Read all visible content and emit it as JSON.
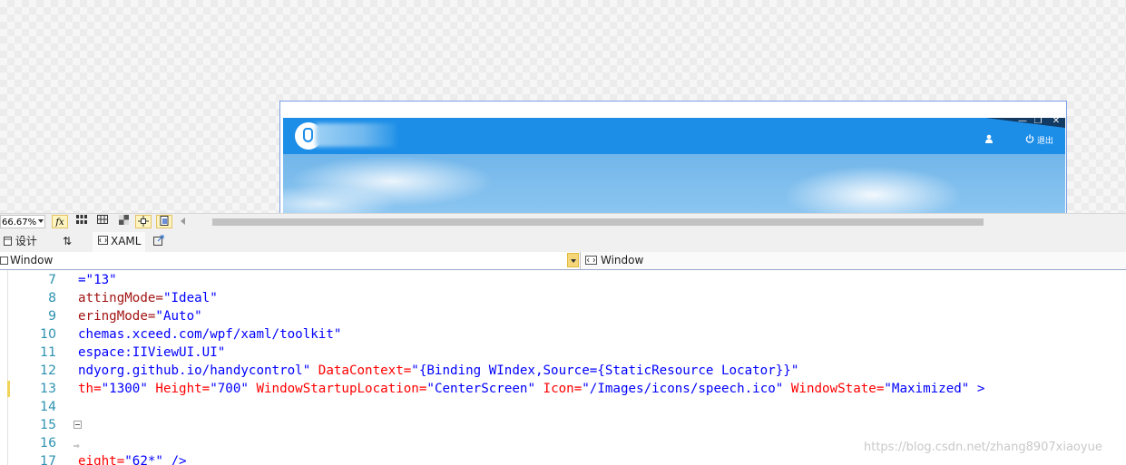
{
  "designer": {
    "app_preview": {
      "window_buttons": [
        "—",
        "❐",
        "✕"
      ],
      "logout_label": "退出"
    }
  },
  "toolbar": {
    "zoom": "66.67%",
    "fx_label": "fx"
  },
  "tabs": {
    "design": "设计",
    "swap": "⇅",
    "xaml": "XAML"
  },
  "nav": {
    "left_value": "Window",
    "right_value": "Window"
  },
  "editor": {
    "lines": [
      {
        "num": "7",
        "parts": [
          {
            "t": "=\"13\"",
            "c": "val"
          }
        ]
      },
      {
        "num": "8",
        "parts": [
          {
            "t": "attingMode=",
            "c": "attr2"
          },
          {
            "t": "\"Ideal\"",
            "c": "val"
          }
        ]
      },
      {
        "num": "9",
        "parts": [
          {
            "t": "eringMode=",
            "c": "attr2"
          },
          {
            "t": "\"Auto\"",
            "c": "val"
          }
        ]
      },
      {
        "num": "10",
        "parts": [
          {
            "t": "chemas.xceed.com/wpf/xaml/toolkit\"",
            "c": "val"
          }
        ]
      },
      {
        "num": "11",
        "parts": [
          {
            "t": "espace:IIViewUI.UI\"",
            "c": "val"
          }
        ]
      },
      {
        "num": "12",
        "parts": [
          {
            "t": "ndyorg.github.io/handycontrol\"",
            "c": "val"
          },
          {
            "t": " DataContext=",
            "c": "attr"
          },
          {
            "t": "\"{Binding WIndex,Source={StaticResource Locator}}\"",
            "c": "val"
          }
        ]
      },
      {
        "num": "13",
        "parts": [
          {
            "t": "th=",
            "c": "attr"
          },
          {
            "t": "\"1300\"",
            "c": "val"
          },
          {
            "t": " Height=",
            "c": "attr"
          },
          {
            "t": "\"700\"",
            "c": "val"
          },
          {
            "t": " WindowStartupLocation=",
            "c": "attr"
          },
          {
            "t": "\"CenterScreen\"",
            "c": "val"
          },
          {
            "t": " Icon=",
            "c": "attr"
          },
          {
            "t": "\"/Images/icons/speech.ico\"",
            "c": "val"
          },
          {
            "t": " WindowState=",
            "c": "attr"
          },
          {
            "t": "\"Maximized\"",
            "c": "val"
          },
          {
            "t": " >",
            "c": "val"
          }
        ]
      },
      {
        "num": "14",
        "parts": []
      },
      {
        "num": "15",
        "parts": []
      },
      {
        "num": "16",
        "parts": []
      },
      {
        "num": "17",
        "parts": [
          {
            "t": "eight=",
            "c": "attr"
          },
          {
            "t": "\"62*\"",
            "c": "val"
          },
          {
            "t": " />",
            "c": "val"
          }
        ]
      }
    ]
  },
  "watermark": "https://blog.csdn.net/zhang8907xiaoyue"
}
